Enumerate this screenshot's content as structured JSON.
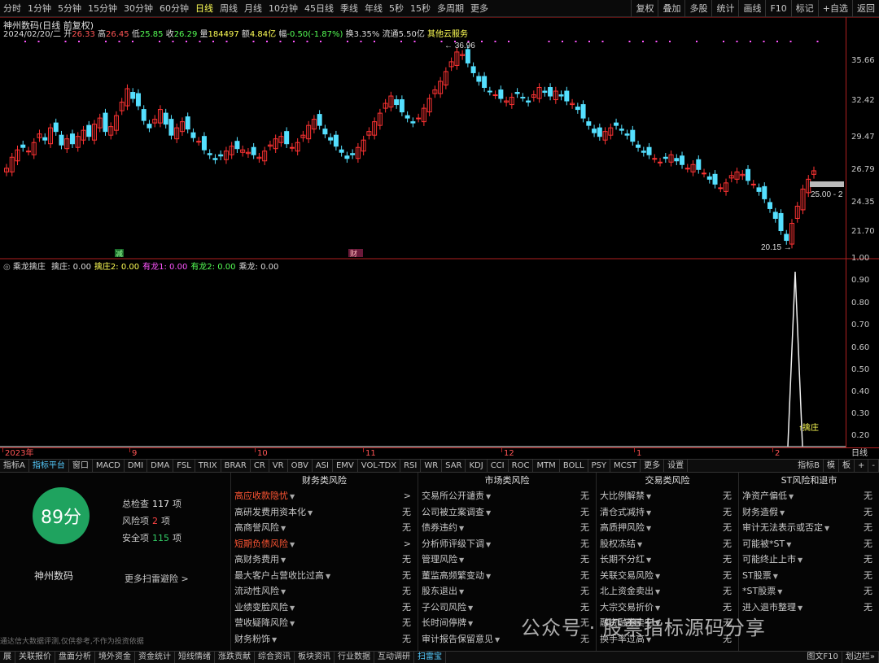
{
  "toolbar": {
    "periods": [
      "分时",
      "1分钟",
      "5分钟",
      "15分钟",
      "30分钟",
      "60分钟",
      "日线",
      "周线",
      "月线",
      "10分钟",
      "45日线",
      "季线",
      "年线",
      "5秒",
      "15秒",
      "多周期",
      "更多"
    ],
    "active_period": "日线",
    "right_buttons": [
      "复权",
      "叠加",
      "多股",
      "统计",
      "画线",
      "F10",
      "标记",
      "+自选",
      "返回"
    ]
  },
  "stock": {
    "title": "神州数码(日线 前复权)",
    "date": "2024/02/20/二",
    "open_label": "开",
    "open": "26.33",
    "high_label": "高",
    "high": "26.45",
    "low_label": "低",
    "low": "25.85",
    "close_label": "收",
    "close": "26.29",
    "vol_label": "量",
    "vol": "184497",
    "amount_label": "额",
    "amount": "4.84亿",
    "chg_label": "幅",
    "chg": "-0.50(-1.87%)",
    "turnover_label": "换",
    "turnover": "3.35%",
    "float_label": "流通",
    "float": "5.50亿",
    "sector": "其他云服务",
    "high_mark": "36.96",
    "low_mark": "20.15",
    "cursor_mark": "25.00 - 2"
  },
  "y_axis": [
    "35.66",
    "32.42",
    "29.47",
    "26.79",
    "24.35",
    "21.70"
  ],
  "sub_indicator": {
    "name": "乘龙擒庄",
    "items": [
      {
        "label": "擒庄:",
        "value": "0.00",
        "color": "#dddddd"
      },
      {
        "label": "擒庄2:",
        "value": "0.00",
        "color": "#ffff55"
      },
      {
        "label": "有龙1:",
        "value": "0.00",
        "color": "#ff55ff"
      },
      {
        "label": "有龙2:",
        "value": "0.00",
        "color": "#55ff55"
      },
      {
        "label": "乘龙:",
        "value": "0.00",
        "color": "#dddddd"
      }
    ],
    "y_axis": [
      "1.00",
      "0.90",
      "0.80",
      "0.70",
      "0.60",
      "0.50",
      "0.40",
      "0.30",
      "0.20"
    ],
    "spike_label": "擒庄"
  },
  "markers": {
    "reduce": "减",
    "finance": "财"
  },
  "date_axis": [
    "2023年",
    "9",
    "10",
    "11",
    "12",
    "1",
    "2"
  ],
  "date_axis_right": "日线",
  "indicator_tabs": [
    "指标A",
    "指标平台",
    "窗口",
    "MACD",
    "DMI",
    "DMA",
    "FSL",
    "TRIX",
    "BRAR",
    "CR",
    "VR",
    "OBV",
    "ASI",
    "EMV",
    "VOL-TDX",
    "RSI",
    "WR",
    "SAR",
    "KDJ",
    "CCI",
    "ROC",
    "MTM",
    "BOLL",
    "PSY",
    "MCST",
    "更多",
    "设置"
  ],
  "indicator_tabs_right": [
    "指标B",
    "模",
    "板",
    "+",
    "-"
  ],
  "panel": {
    "score": "89分",
    "name": "神州数码",
    "stats": [
      {
        "label": "总检查",
        "value": "117",
        "unit": "项",
        "color": "normal"
      },
      {
        "label": "风险项",
        "value": "2",
        "unit": "项",
        "color": "red"
      },
      {
        "label": "安全项",
        "value": "115",
        "unit": "项",
        "color": "green"
      }
    ],
    "more": "更多扫雷避险 >",
    "disclaimer": "通达信大数据评测,仅供参考,不作为投资依据",
    "columns": [
      {
        "title": "财务类风险",
        "rows": [
          {
            "label": "高应收款隐忧",
            "value": ">",
            "warn": true
          },
          {
            "label": "高研发费用资本化",
            "value": "无"
          },
          {
            "label": "高商誉风险",
            "value": "无"
          },
          {
            "label": "短期负债风险",
            "value": ">",
            "warn": true
          },
          {
            "label": "高财务费用",
            "value": "无"
          },
          {
            "label": "最大客户占营收比过高",
            "value": "无"
          },
          {
            "label": "流动性风险",
            "value": "无"
          },
          {
            "label": "业绩变脸风险",
            "value": "无"
          },
          {
            "label": "营收疑降风险",
            "value": "无"
          },
          {
            "label": "财务粉饰",
            "value": "无"
          }
        ]
      },
      {
        "title": "市场类风险",
        "rows": [
          {
            "label": "交易所公开谴责",
            "value": "无"
          },
          {
            "label": "公司被立案调查",
            "value": "无"
          },
          {
            "label": "债券违约",
            "value": "无"
          },
          {
            "label": "分析师评级下调",
            "value": "无"
          },
          {
            "label": "管理风险",
            "value": "无"
          },
          {
            "label": "董监高频繁变动",
            "value": "无"
          },
          {
            "label": "股东退出",
            "value": "无"
          },
          {
            "label": "子公司风险",
            "value": "无"
          },
          {
            "label": "长时间停牌",
            "value": "无"
          },
          {
            "label": "审计报告保留意见",
            "value": "无"
          }
        ]
      },
      {
        "title": "交易类风险",
        "rows": [
          {
            "label": "大比例解禁",
            "value": "无"
          },
          {
            "label": "清仓式减持",
            "value": "无"
          },
          {
            "label": "高质押风险",
            "value": "无"
          },
          {
            "label": "股权冻结",
            "value": "无"
          },
          {
            "label": "长期不分红",
            "value": "无"
          },
          {
            "label": "关联交易风险",
            "value": "无"
          },
          {
            "label": "北上资金卖出",
            "value": "无"
          },
          {
            "label": "大宗交易折价",
            "value": "无"
          },
          {
            "label": "融资融券卖空",
            "value": "无"
          },
          {
            "label": "换手率过高",
            "value": "无"
          }
        ]
      },
      {
        "title": "ST风险和退市",
        "rows": [
          {
            "label": "净资产偏低",
            "value": "无"
          },
          {
            "label": "财务造假",
            "value": "无"
          },
          {
            "label": "审计无法表示或否定",
            "value": "无"
          },
          {
            "label": "可能被*ST",
            "value": "无"
          },
          {
            "label": "可能终止上市",
            "value": "无"
          },
          {
            "label": "ST股票",
            "value": "无"
          },
          {
            "label": "*ST股票",
            "value": "无"
          },
          {
            "label": "进入退市整理",
            "value": "无"
          }
        ]
      }
    ]
  },
  "bottom_tabs": [
    "展",
    "关联报价",
    "盘面分析",
    "境外资金",
    "资金统计",
    "短线情绪",
    "涨跌贡献",
    "综合资讯",
    "板块资讯",
    "行业数据",
    "互动调研",
    "扫雷宝"
  ],
  "bottom_active": "扫雷宝",
  "bottom_right": [
    "图文F10",
    "划边栏»"
  ],
  "watermark": "公众号 · 股票指标源码分享",
  "colors": {
    "up": "#ff3333",
    "down": "#55e0ff",
    "grid": "#b02020",
    "accent": "#ffff55",
    "score": "#1fa35f"
  }
}
